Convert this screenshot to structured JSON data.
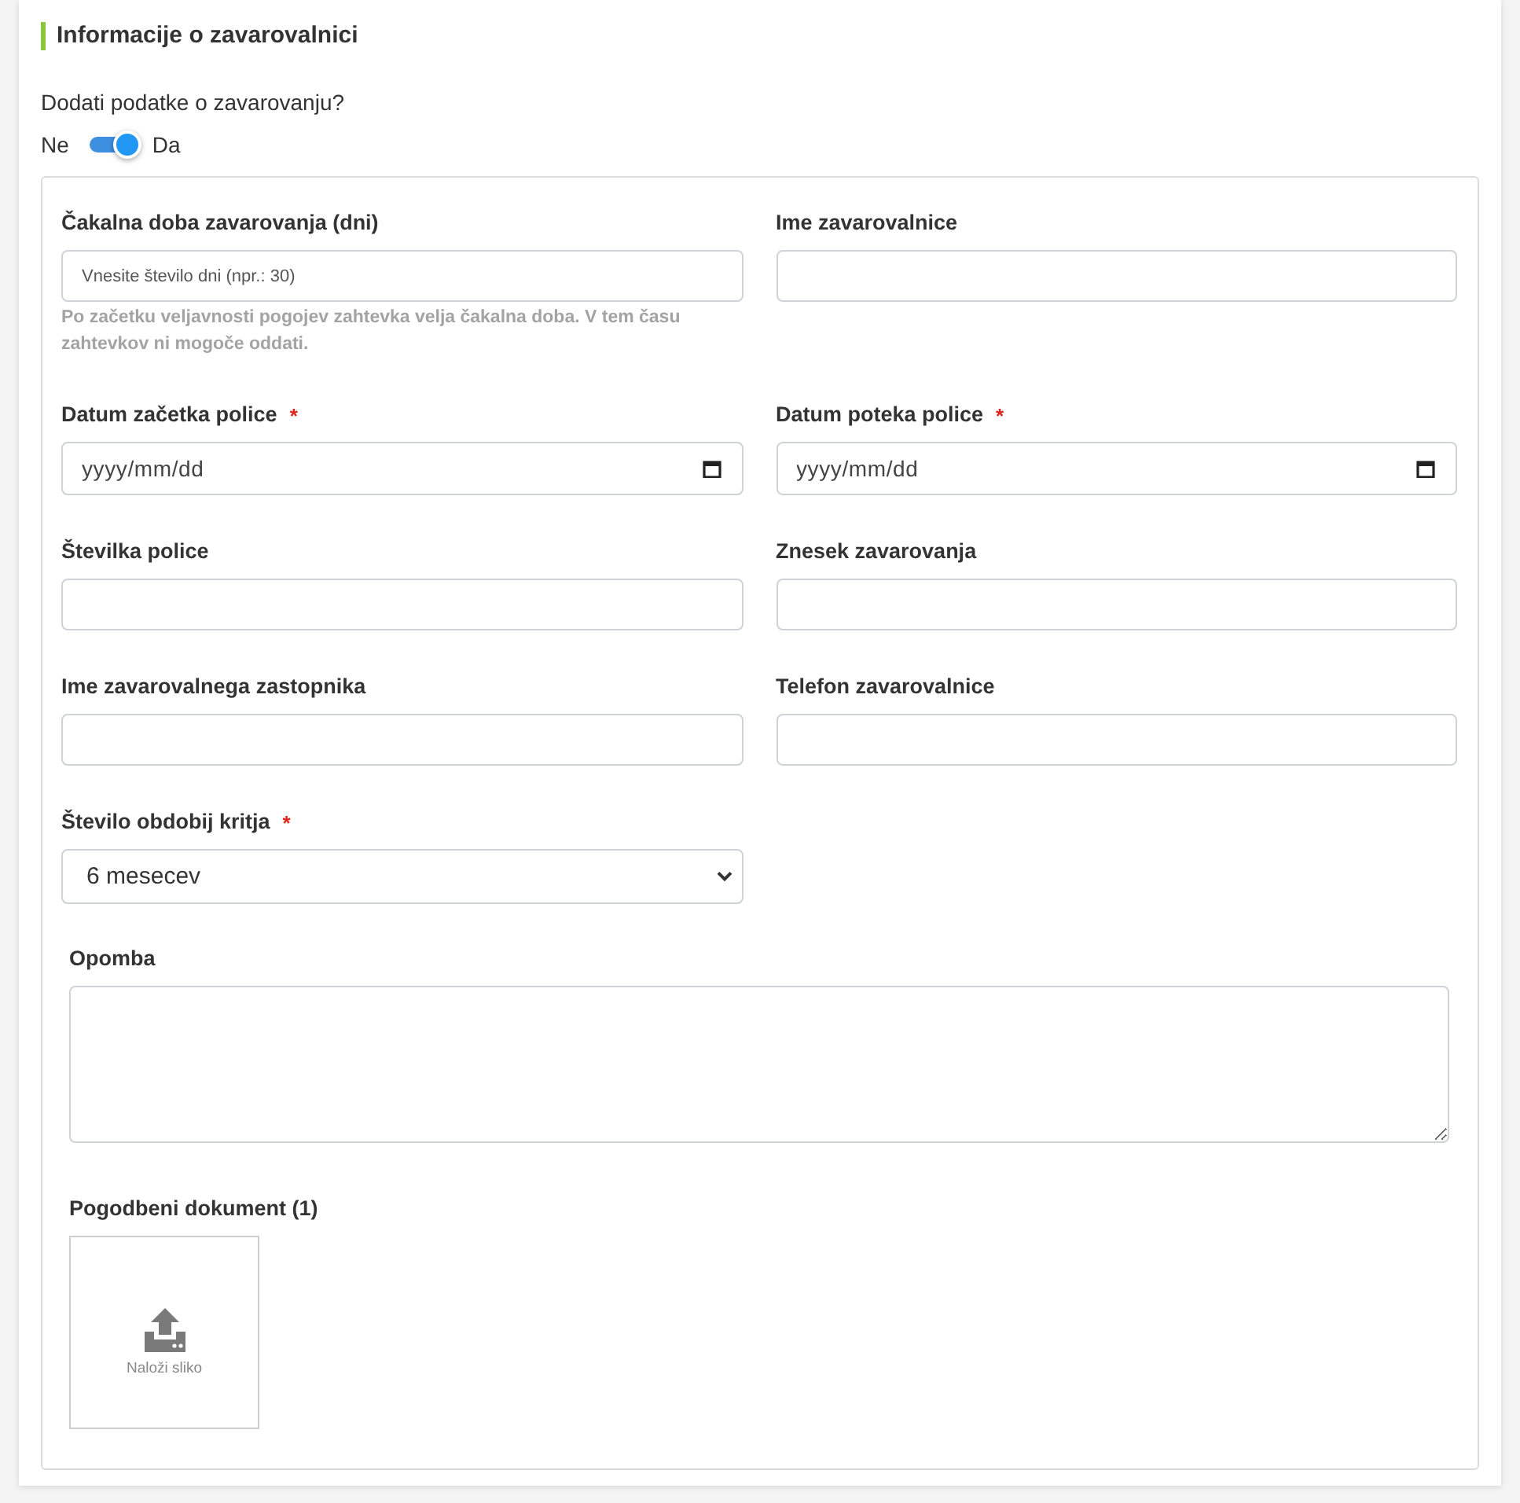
{
  "section": {
    "title": "Informacije o zavarovalnici"
  },
  "insurance_toggle": {
    "question": "Dodati podatke o zavarovanju?",
    "off_label": "Ne",
    "on_label": "Da",
    "on": true
  },
  "fields": [
    {
      "kind": "text",
      "label": "Čakalna doba zavarovanja (dni)",
      "placeholder": "Vnesite število dni (npr.: 30)",
      "help": "Po začetku veljavnosti pogojev zahtevka velja čakalna doba. V tem času zahtevkov ni mogoče oddati."
    },
    {
      "kind": "text",
      "label": "Ime zavarovalnice"
    },
    {
      "kind": "date",
      "label": "Datum začetka police",
      "required_mark": "*",
      "placeholder": "yyyy/mm/dd"
    },
    {
      "kind": "date",
      "label": "Datum poteka police",
      "required_mark": "*",
      "placeholder": "yyyy/mm/dd"
    },
    {
      "kind": "text",
      "label": "Številka police"
    },
    {
      "kind": "text",
      "label": "Znesek zavarovanja"
    },
    {
      "kind": "text",
      "label": "Ime zavarovalnega zastopnika"
    },
    {
      "kind": "text",
      "label": "Telefon zavarovalnice"
    },
    {
      "kind": "select",
      "label": "Število obdobij kritja",
      "required_mark": "*",
      "value": "6 mesecev"
    }
  ],
  "note": {
    "label": "Opomba"
  },
  "upload": {
    "label": "Pogodbeni dokument (1)",
    "button": "Naloži sliko"
  }
}
